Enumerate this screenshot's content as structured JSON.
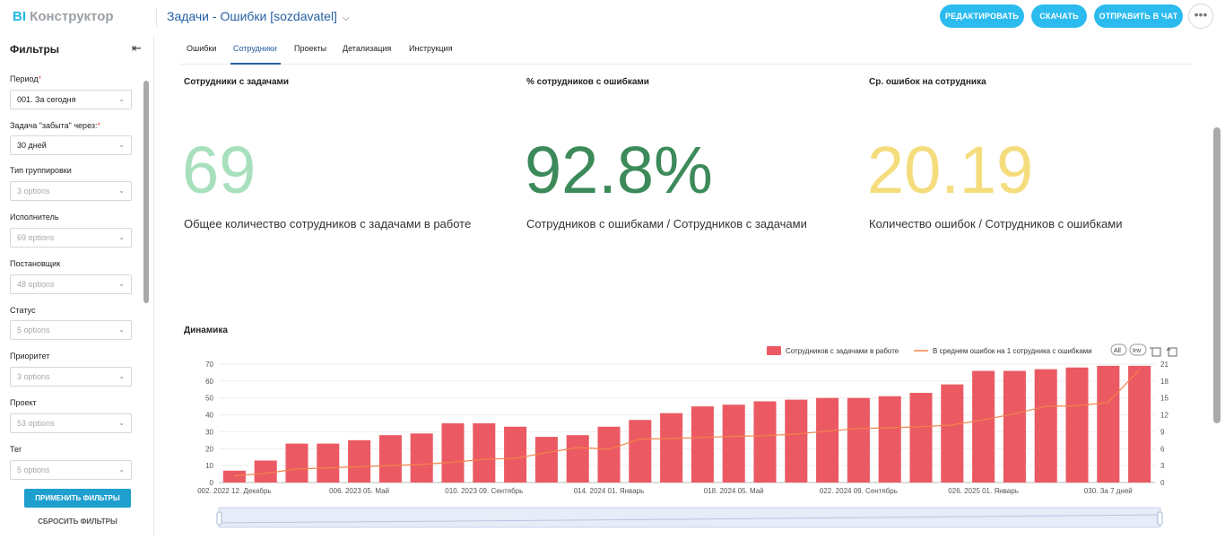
{
  "app": {
    "logo_bi": "BI",
    "logo_text": " Конструктор",
    "title": "Задачи - Ошибки [sozdavatel]"
  },
  "toolbar": {
    "edit_label": "РЕДАКТИРОВАТЬ",
    "download_label": "СКАЧАТЬ",
    "send_label": "ОТПРАВИТЬ В ЧАТ",
    "more_label": "•••"
  },
  "sidebar": {
    "title": "Фильтры",
    "filters": [
      {
        "label": "Период",
        "required": "*",
        "value": "001. За сегодня",
        "placeholder": false
      },
      {
        "label": "Задача \"забыта\" через:",
        "required": "*",
        "value": "30 дней",
        "placeholder": false
      },
      {
        "label": "Тип группировки",
        "required": "",
        "value": "3 options",
        "placeholder": true
      },
      {
        "label": "Исполнитель",
        "required": "",
        "value": "69 options",
        "placeholder": true
      },
      {
        "label": "Постановщик",
        "required": "",
        "value": "48 options",
        "placeholder": true
      },
      {
        "label": "Статус",
        "required": "",
        "value": "5 options",
        "placeholder": true
      },
      {
        "label": "Приоритет",
        "required": "",
        "value": "3 options",
        "placeholder": true
      },
      {
        "label": "Проект",
        "required": "",
        "value": "53 options",
        "placeholder": true
      },
      {
        "label": "Тег",
        "required": "",
        "value": "5 options",
        "placeholder": true
      }
    ],
    "apply_label": "ПРИМЕНИТЬ ФИЛЬТРЫ",
    "reset_label": "СБРОСИТЬ ФИЛЬТРЫ"
  },
  "tabs": [
    "Ошибки",
    "Сотрудники",
    "Проекты",
    "Детализация",
    "Инструкция"
  ],
  "active_tab": "Сотрудники",
  "kpis": [
    {
      "title": "Сотрудники с задачами",
      "value": "69",
      "desc": "Общее количество сотрудников с задачами в работе",
      "color": "#a8e0bd"
    },
    {
      "title": "% сотрудников с ошибками",
      "value": "92.8%",
      "desc": "Сотрудников с ошибками / Сотрудников с задачами",
      "color": "#3c8a59"
    },
    {
      "title": "Ср. ошибок на сотрудника",
      "value": "20.19",
      "desc": "Количество ошибок / Сотрудников с ошибками",
      "color": "#f5dd7d"
    }
  ],
  "dynamics": {
    "title": "Динамика",
    "legend_bar": "Сотрудников с задачами в работе",
    "legend_line": "В среднем ошибок на 1 сотрудника с ошибками",
    "btn_all": "All",
    "btn_inv": "Inv"
  },
  "chart_data": {
    "type": "bar",
    "x_tick_labels": [
      "002. 2022 12. Декабрь",
      "006. 2023 05. Май",
      "010. 2023 09. Сентябрь",
      "014. 2024 01. Январь",
      "018. 2024 05. Май",
      "022. 2024 09. Сентябрь",
      "026. 2025 01. Январь",
      "030. За 7 дней"
    ],
    "series": [
      {
        "name": "Сотрудников с задачами в работе",
        "axis": "left",
        "color": "#eb5a63",
        "values": [
          7,
          13,
          23,
          23,
          25,
          28,
          29,
          35,
          35,
          33,
          27,
          28,
          33,
          37,
          41,
          45,
          46,
          48,
          49,
          50,
          50,
          51,
          53,
          58,
          66,
          66,
          67,
          68,
          69,
          69
        ]
      },
      {
        "name": "В среднем ошибок на 1 сотрудника с ошибками",
        "axis": "right",
        "color": "#f4824a",
        "values": [
          1.2,
          1.6,
          2.4,
          2.6,
          2.8,
          3.0,
          3.2,
          3.6,
          4.1,
          4.3,
          5.3,
          6.2,
          5.9,
          7.7,
          7.8,
          8.0,
          8.2,
          8.3,
          8.6,
          9.1,
          9.6,
          9.7,
          9.9,
          10.2,
          11.1,
          12.2,
          13.5,
          13.6,
          14.2,
          20.0
        ]
      }
    ],
    "ylim_left": [
      0,
      70
    ],
    "ylim_right": [
      0,
      21
    ],
    "yticks_left": [
      0,
      10,
      20,
      30,
      40,
      50,
      60,
      70
    ],
    "yticks_right": [
      0,
      3,
      6,
      9,
      12,
      15,
      18,
      21
    ],
    "legend": "top-right",
    "grid": true
  }
}
